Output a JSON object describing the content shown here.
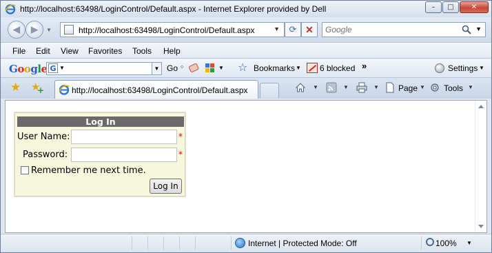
{
  "window": {
    "title": "http://localhost:63498/LoginControl/Default.aspx - Internet Explorer provided by Dell",
    "controls": {
      "minimize": "–",
      "maximize": "□",
      "close": "✕"
    }
  },
  "address_bar": {
    "url": "http://localhost:63498/LoginControl/Default.aspx",
    "search_placeholder": "Google"
  },
  "menu": [
    "File",
    "Edit",
    "View",
    "Favorites",
    "Tools",
    "Help"
  ],
  "google_toolbar": {
    "go_label": "Go",
    "bookmarks_label": "Bookmarks",
    "popup_blocker_label": "6 blocked",
    "more_label": "»",
    "settings_label": "Settings"
  },
  "tabs": [
    {
      "label": "http://localhost:63498/LoginControl/Default.aspx",
      "active": true
    }
  ],
  "command_bar": {
    "page_label": "Page",
    "tools_label": "Tools"
  },
  "login": {
    "header": "Log In",
    "username_label": "User Name:",
    "password_label": "Password:",
    "username_value": "",
    "password_value": "",
    "required_marker": "*",
    "remember_label": "Remember me next time.",
    "remember_checked": false,
    "submit_label": "Log In"
  },
  "status_bar": {
    "zone": "Internet | Protected Mode: Off",
    "zoom": "100%"
  },
  "colors": {
    "login_header_bg": "#6b696b",
    "login_bg": "#f7f7de",
    "required": "#e00000"
  }
}
